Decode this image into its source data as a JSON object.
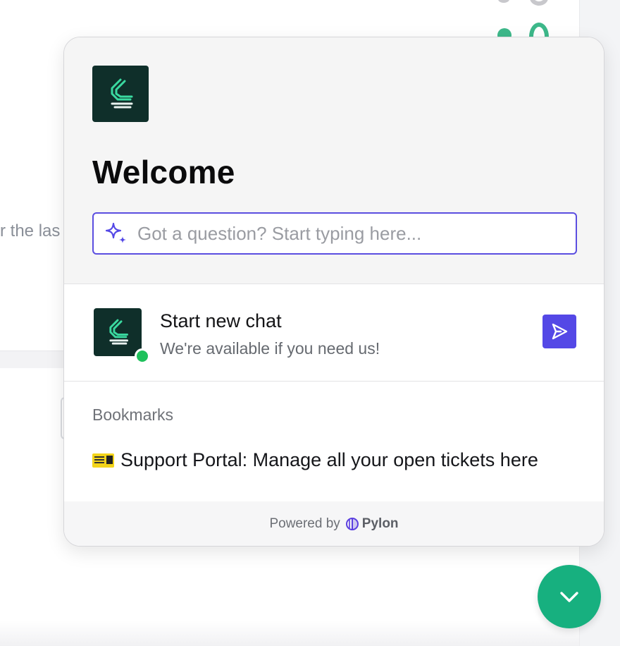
{
  "background": {
    "partial_text": "r the las"
  },
  "widget": {
    "title": "Welcome",
    "search": {
      "placeholder": "Got a question? Start typing here...",
      "value": ""
    },
    "new_chat": {
      "title": "Start new chat",
      "subtitle": "We're available if you need us!"
    },
    "bookmarks": {
      "heading": "Bookmarks",
      "items": [
        {
          "icon": "ticket-icon",
          "label": "Support Portal: Manage all your open tickets here"
        }
      ]
    },
    "footer": {
      "powered_by": "Powered by",
      "brand": "Pylon"
    }
  },
  "icons": {
    "search": "sparkle-icon",
    "send": "send-icon",
    "launcher": "chevron-down-icon",
    "logo": "brand-logo-icon",
    "footer_brand": "pylon-logo-icon"
  },
  "colors": {
    "accent": "#5448e6",
    "search_border": "#5b4ee0",
    "online": "#1fc15c",
    "launcher": "#17b07f",
    "logo_bg": "#0f2f2a",
    "logo_fg": "#3ad9a0"
  }
}
